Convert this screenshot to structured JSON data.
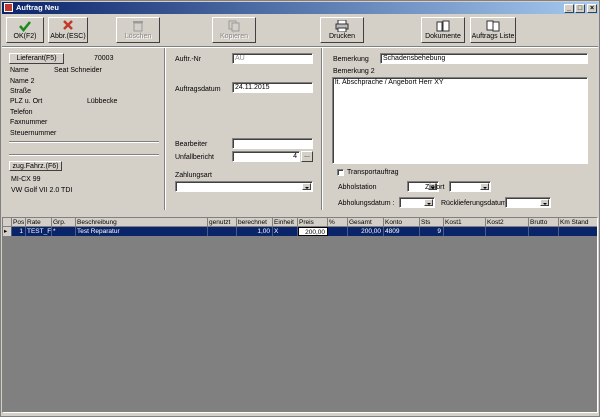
{
  "window": {
    "title": "Auftrag Neu"
  },
  "toolbar": {
    "ok": "OK(F2)",
    "abbr": "Abbr.(ESC)",
    "loeschen": "Löschen",
    "kopieren": "Kopieren",
    "drucken": "Drucken",
    "dokumente": "Dokumente",
    "auftragsliste": "Auftrags Liste"
  },
  "left": {
    "lieferant_btn": "Lieferant(F5)",
    "lieferant_nr": "70003",
    "rows": [
      {
        "label": "Name",
        "value": "Seat Schneider"
      },
      {
        "label": "Name 2",
        "value": ""
      },
      {
        "label": "Straße",
        "value": ""
      },
      {
        "label": "PLZ u. Ort",
        "value": "Lübbecke"
      },
      {
        "label": "Telefon",
        "value": ""
      },
      {
        "label": "Faxnummer",
        "value": ""
      },
      {
        "label": "Steuernummer",
        "value": ""
      }
    ],
    "fahrzeug_btn": "zug.Fahrz.(F6)",
    "kennzeichen": "MI-CX 99",
    "fahrzeug": "VW Golf VII 2.0 TDI"
  },
  "middle": {
    "auftr_nr_label": "Auftr.-Nr",
    "auftr_nr_value": "AU",
    "auftragsdatum_label": "Auftragsdatum",
    "auftragsdatum_value": "24.11.2015",
    "bearbeiter_label": "Bearbeiter",
    "bearbeiter_value": "",
    "unfallbericht_label": "Unfallbericht",
    "unfallbericht_value": "4",
    "unfallbericht_btn": "...",
    "zahlungsart_label": "Zahlungsart",
    "zahlungsart_value": ""
  },
  "right": {
    "bemerkung_label": "Bemerkung",
    "bemerkung_value": "Schadensbehebung",
    "bemerkung2_label": "Bemerkung 2",
    "bemerkung2_value": "lt. Abschprache / Angebort Herr XY",
    "transportauftrag_label": "Transportauftrag",
    "transportauftrag_checked": false,
    "abholstation_label": "Abholstation",
    "zielort_label": "Zielort",
    "abholungsdatum_label": "Abholungsdatum :",
    "rueckliefer_label": "Rücklieferungsdatum :"
  },
  "grid": {
    "columns": [
      "Pos",
      "Rate",
      "Grp.",
      "Beschreibung",
      "genutzt",
      "berechnet",
      "Einheit",
      "Preis",
      "%",
      "Gesamt",
      "Konto",
      "Sts",
      "Kost1",
      "Kost2",
      "Brutto",
      "Km Stand"
    ],
    "rows": [
      {
        "indicator": "▸",
        "pos": "1",
        "rate": "TEST_F",
        "grp": "*",
        "beschreibung": "Test Reparatur",
        "genutzt": "",
        "berechnet": "1,00",
        "einheit": "X",
        "preis": "200,00",
        "prozent": "",
        "gesamt": "200,00",
        "konto": "4809",
        "sts": "9",
        "kost1": "",
        "kost2": "",
        "brutto": "",
        "km_stand": ""
      }
    ]
  },
  "colors": {
    "titlebar": "#0a246a",
    "selection": "#0a246a",
    "face": "#d4d0c8",
    "ok_check": "#1a8a1a",
    "abbr_x": "#c0392b"
  }
}
